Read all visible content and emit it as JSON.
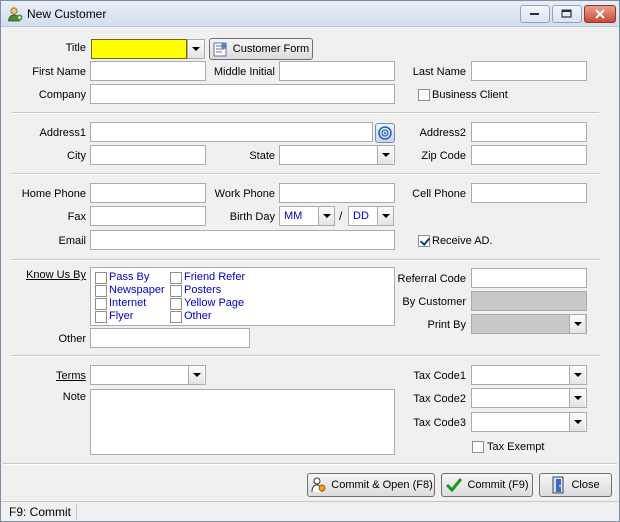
{
  "window": {
    "title": "New Customer"
  },
  "header": {
    "title_label": "Title",
    "customer_form_button": "Customer Form"
  },
  "name": {
    "first_name_label": "First Name",
    "middle_initial_label": "Middle Initial",
    "last_name_label": "Last Name",
    "company_label": "Company",
    "business_client_label": "Business Client"
  },
  "address": {
    "address1_label": "Address1",
    "address2_label": "Address2",
    "city_label": "City",
    "state_label": "State",
    "zip_label": "Zip Code"
  },
  "contact": {
    "home_phone_label": "Home Phone",
    "work_phone_label": "Work Phone",
    "cell_phone_label": "Cell Phone",
    "fax_label": "Fax",
    "birthday_label": "Birth Day",
    "birth_month_value": "MM",
    "birth_sep": "/",
    "birth_day_value": "DD",
    "email_label": "Email",
    "receive_ad_label": "Receive AD.",
    "receive_ad_checked": true
  },
  "referral": {
    "know_us_by_label": "Know Us By",
    "options_col1": [
      "Pass By",
      "Newspaper",
      "Internet",
      "Flyer"
    ],
    "options_col2": [
      "Friend Refer",
      "Posters",
      "Yellow Page",
      "Other"
    ],
    "referral_code_label": "Referral Code",
    "by_customer_label": "By Customer",
    "print_by_label": "Print By",
    "other_label": "Other"
  },
  "tax": {
    "terms_label": "Terms",
    "note_label": "Note",
    "tax_code1_label": "Tax Code1",
    "tax_code2_label": "Tax Code2",
    "tax_code3_label": "Tax Code3",
    "tax_exempt_label": "Tax Exempt"
  },
  "actions": {
    "commit_open_button": "Commit & Open (F8)",
    "commit_button": "Commit (F9)",
    "close_button": "Close"
  },
  "status": {
    "hint": "F9: Commit"
  },
  "colors": {
    "title_field_bg": "#ffff00",
    "option_text": "#0000cc",
    "disabled_field": "#c8c8c8"
  }
}
